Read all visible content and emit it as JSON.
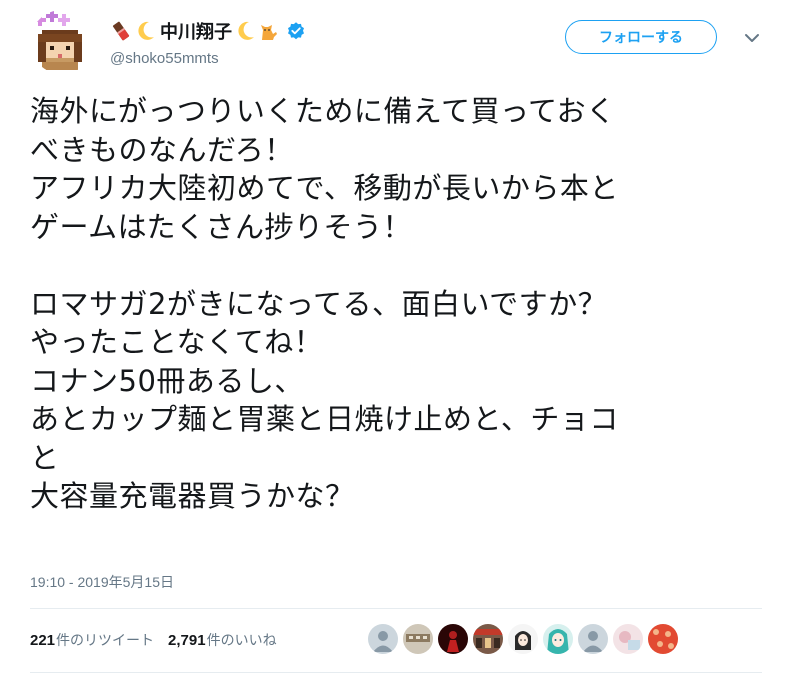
{
  "user": {
    "display_name": "中川翔子",
    "handle": "@shoko55mmts",
    "verified_icon": "verified-badge-icon",
    "name_emojis_before": [
      "chocolate-bar-emoji",
      "crescent-moon-emoji"
    ],
    "name_emojis_after": [
      "crescent-moon-emoji",
      "cat-emoji"
    ]
  },
  "follow_button": {
    "label": "フォローする",
    "accent": "#1da1f2"
  },
  "menu_icon": "chevron-down-icon",
  "tweet": {
    "text": "海外にがっつりいくために備えて買っておく\nべきものなんだろ！\nアフリカ大陸初めてで、移動が長いから本と\nゲームはたくさん捗りそう！\n\nロマサガ2がきになってる、面白いですか？\nやったことなくてね！\nコナン50冊あるし、\nあとカップ麺と胃薬と日焼け止めと、チョコ\nと\n大容量充電器買うかな？",
    "timestamp": "19:10 - 2019年5月15日"
  },
  "stats": {
    "retweets_count": "221",
    "retweets_label": "件のリツイート",
    "likes_count": "2,791",
    "likes_label": "件のいいね"
  },
  "likers": [
    {
      "name": "default-avatar",
      "color": "#aab8c2"
    },
    {
      "name": "food-photo-avatar",
      "color": "#bdb6a8"
    },
    {
      "name": "red-figure-avatar",
      "color": "#3a0a0a"
    },
    {
      "name": "storefront-avatar",
      "color": "#6b4a3a"
    },
    {
      "name": "anime-girl-avatar",
      "color": "#f2f2f2"
    },
    {
      "name": "teal-character-avatar",
      "color": "#3fb8b0"
    },
    {
      "name": "default-avatar",
      "color": "#aab8c2"
    },
    {
      "name": "pastel-photo-avatar",
      "color": "#e9cfd4"
    },
    {
      "name": "red-pattern-avatar",
      "color": "#d8452f"
    }
  ],
  "colors": {
    "text_primary": "#14171a",
    "text_secondary": "#657786",
    "divider": "#e6ecf0"
  }
}
